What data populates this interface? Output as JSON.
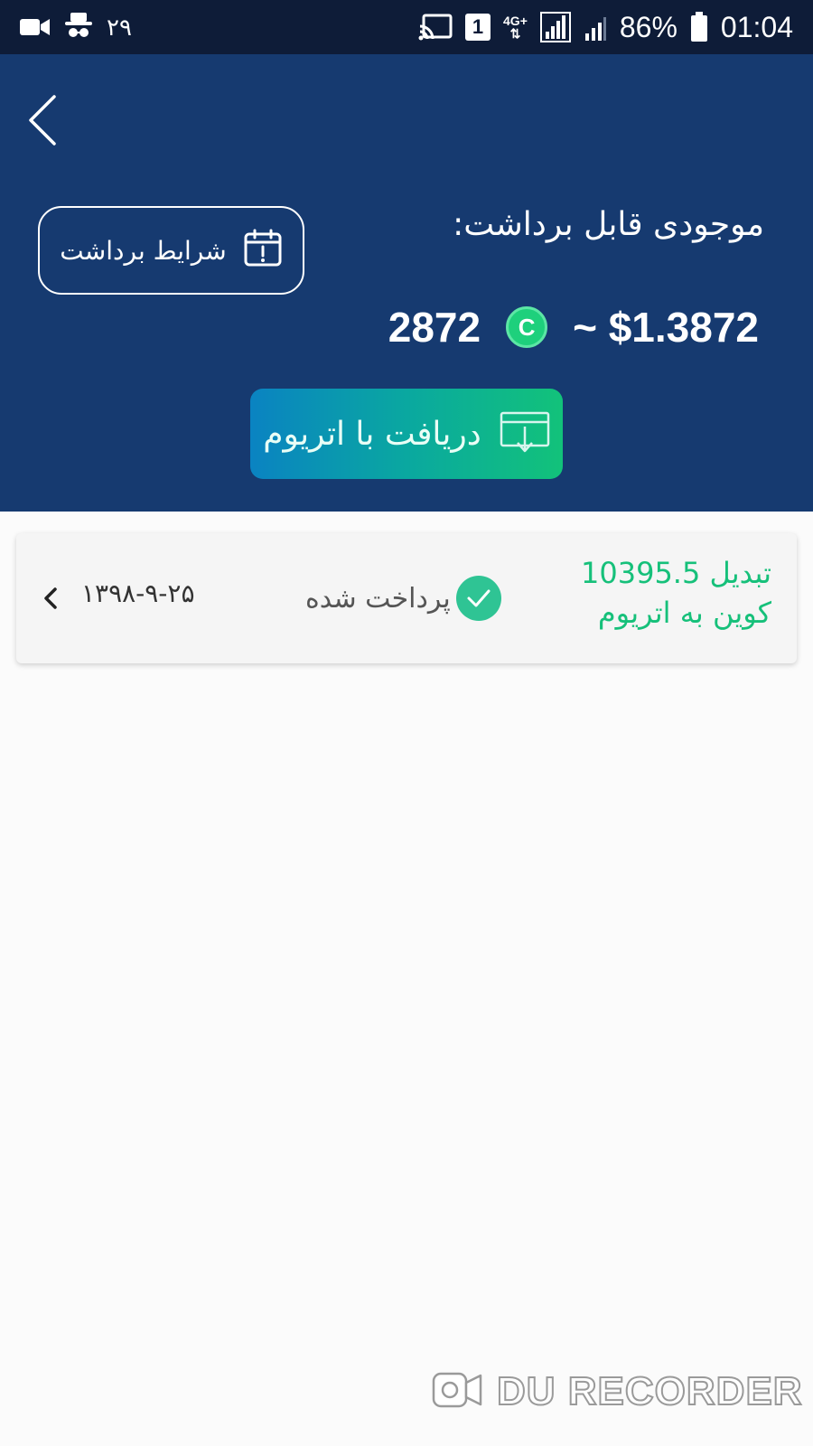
{
  "status_bar": {
    "date_num": "۲۹",
    "sim_slot": "1",
    "network": "4G+",
    "battery": "86%",
    "time": "01:04"
  },
  "header": {
    "balance_title": "موجودی قابل برداشت:",
    "terms_button": "شرایط برداشت",
    "coin_amount": "2872",
    "coin_symbol": "C",
    "usd_amount": "~ $1.3872",
    "receive_button": "دریافت با اتریوم"
  },
  "transactions": [
    {
      "title": "تبدیل 10395.5 کوین به اتریوم",
      "status": "پرداخت شده",
      "date": "۱۳۹۸-۹-۲۵"
    }
  ],
  "watermark": {
    "text": "DU RECORDER"
  },
  "colors": {
    "status_bar": "#0e1c38",
    "header": "#163a70",
    "accent_green": "#16c07a",
    "button_gradient_start": "#0a83c2",
    "button_gradient_end": "#12c27a"
  },
  "icons": {
    "back": "chevron-left-icon",
    "terms": "calendar-alert-icon",
    "receive": "download-tray-icon",
    "coin": "coin-icon",
    "status": "check-circle-icon",
    "row": "chevron-left-icon"
  }
}
